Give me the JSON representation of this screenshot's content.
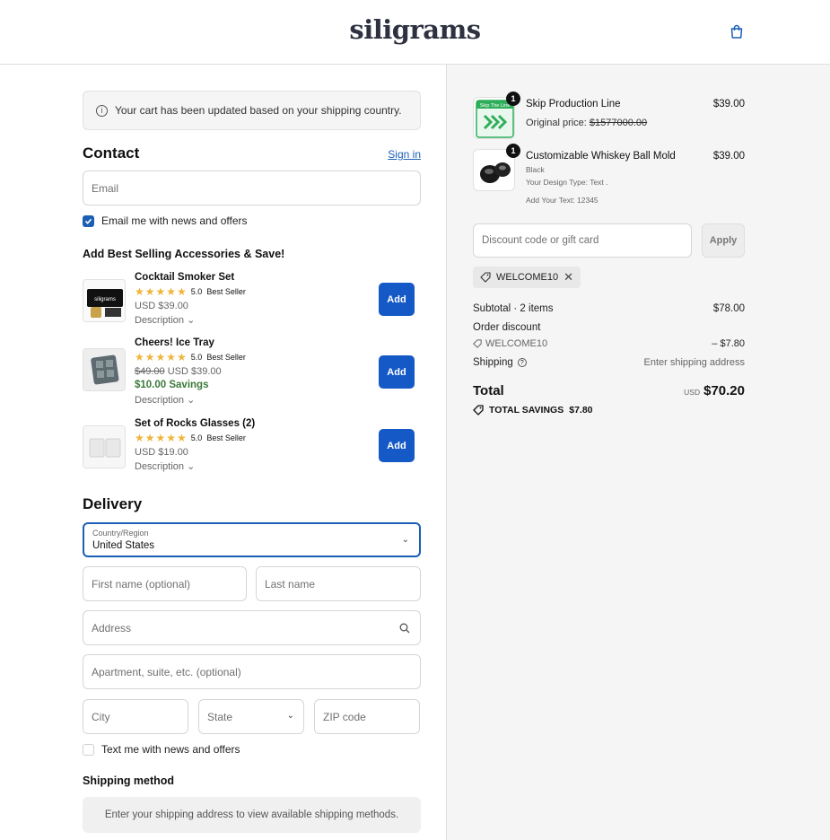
{
  "header": {
    "logo": "siligrams",
    "bag_icon": "shopping-bag-icon"
  },
  "notice": {
    "text": "Your cart has been updated based on your shipping country."
  },
  "contact": {
    "title": "Contact",
    "sign_in": "Sign in",
    "email_placeholder": "Email",
    "email_news_label": "Email me with news and offers",
    "email_news_checked": true
  },
  "accessories": {
    "title": "Add Best Selling Accessories & Save!",
    "items": [
      {
        "name": "Cocktail Smoker Set",
        "rating": "5.0",
        "badge": "Best Seller",
        "price": "USD $39.00",
        "desc": "Description",
        "add": "Add"
      },
      {
        "name": "Cheers! Ice Tray",
        "rating": "5.0",
        "badge": "Best Seller",
        "compare_price": "$49.00",
        "price": "USD $39.00",
        "savings": "$10.00 Savings",
        "desc": "Description",
        "add": "Add"
      },
      {
        "name": "Set of Rocks Glasses (2)",
        "rating": "5.0",
        "badge": "Best Seller",
        "price": "USD $19.00",
        "desc": "Description",
        "add": "Add"
      }
    ]
  },
  "delivery": {
    "title": "Delivery",
    "country_label": "Country/Region",
    "country_value": "United States",
    "first_name_placeholder": "First name (optional)",
    "last_name_placeholder": "Last name",
    "address_placeholder": "Address",
    "apartment_placeholder": "Apartment, suite, etc. (optional)",
    "city_placeholder": "City",
    "state_placeholder": "State",
    "zip_placeholder": "ZIP code",
    "text_news_label": "Text me with news and offers",
    "text_news_checked": false
  },
  "shipping_method": {
    "title": "Shipping method",
    "message": "Enter your shipping address to view available shipping methods."
  },
  "order": {
    "items": [
      {
        "name": "Skip Production Line",
        "qty": "1",
        "original_label": "Original price:",
        "original_price": "$1577000.00",
        "price": "$39.00",
        "thumb_text": "Skip The Line"
      },
      {
        "name": "Customizable Whiskey Ball Mold",
        "qty": "1",
        "variant": "Black",
        "design_type": "Your Design Type: Text .",
        "your_text": "Add Your Text: 12345",
        "price": "$39.00"
      }
    ],
    "discount_placeholder": "Discount code or gift card",
    "apply_label": "Apply",
    "applied_code": "WELCOME10",
    "subtotal_label": "Subtotal · 2 items",
    "subtotal_value": "$78.00",
    "order_discount_label": "Order discount",
    "discount_code": "WELCOME10",
    "discount_value": "– $7.80",
    "shipping_label": "Shipping",
    "shipping_value": "Enter shipping address",
    "total_label": "Total",
    "total_currency": "USD",
    "total_value": "$70.20",
    "savings_label": "TOTAL SAVINGS",
    "savings_value": "$7.80"
  },
  "colors": {
    "accent": "#1559c7",
    "savings_green": "#3a7a3a",
    "panel_bg": "#f5f5f5",
    "star": "#f0b43b"
  }
}
